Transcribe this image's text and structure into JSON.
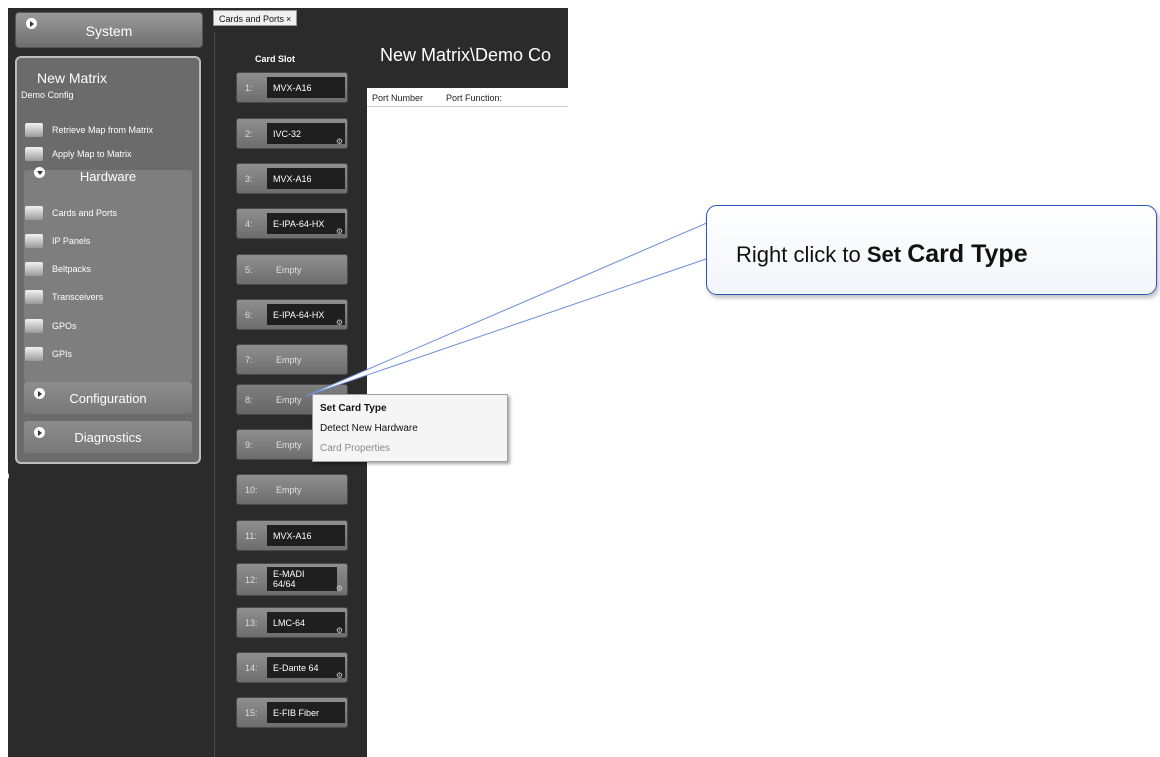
{
  "sidebar": {
    "system_label": "System",
    "matrix_title": "New Matrix",
    "matrix_subtitle": "Demo Config",
    "actions": [
      {
        "label": "Retrieve Map from Matrix",
        "icon": "retrieve-map-icon"
      },
      {
        "label": "Apply Map to Matrix",
        "icon": "apply-map-icon"
      }
    ],
    "hardware_label": "Hardware",
    "hardware_items": [
      {
        "label": "Cards and Ports",
        "icon": "cards-ports-icon"
      },
      {
        "label": "IP Panels",
        "icon": "ip-panels-icon"
      },
      {
        "label": "Beltpacks",
        "icon": "beltpack-icon"
      },
      {
        "label": "Transceivers",
        "icon": "transceiver-icon"
      },
      {
        "label": "GPOs",
        "icon": "gpo-icon"
      },
      {
        "label": "GPIs",
        "icon": "gpi-icon"
      }
    ],
    "configuration_label": "Configuration",
    "diagnostics_label": "Diagnostics"
  },
  "tab": {
    "label": "Cards and Ports",
    "close": "×"
  },
  "card_slot": {
    "header": "Card Slot",
    "slots": [
      {
        "num": "1:",
        "card": "MVX-A16"
      },
      {
        "num": "2:",
        "card": "IVC-32"
      },
      {
        "num": "3:",
        "card": "MVX-A16"
      },
      {
        "num": "4:",
        "card": "E-IPA-64-HX"
      },
      {
        "num": "5:",
        "card": "Empty"
      },
      {
        "num": "6:",
        "card": "E-IPA-64-HX"
      },
      {
        "num": "7:",
        "card": "Empty"
      },
      {
        "num": "8:",
        "card": "Empty"
      },
      {
        "num": "9:",
        "card": "Empty"
      },
      {
        "num": "10:",
        "card": "Empty"
      },
      {
        "num": "11:",
        "card": "MVX-A16"
      },
      {
        "num": "12:",
        "card": "E-MADI 64/64"
      },
      {
        "num": "13:",
        "card": "LMC-64"
      },
      {
        "num": "14:",
        "card": "E-Dante 64"
      },
      {
        "num": "15:",
        "card": "E-FIB Fiber"
      }
    ]
  },
  "main": {
    "title": "New Matrix\\Demo Co",
    "columns": [
      "Port Number",
      "Port Function:"
    ]
  },
  "context_menu": {
    "items": [
      {
        "label": "Set Card Type",
        "bold": true,
        "enabled": true
      },
      {
        "label": "Detect New Hardware",
        "bold": false,
        "enabled": true
      },
      {
        "label": "Card Properties",
        "bold": false,
        "enabled": false
      }
    ]
  },
  "callout": {
    "prefix": "Right click to ",
    "bold1": "Set",
    "bold2": "Card Type"
  }
}
